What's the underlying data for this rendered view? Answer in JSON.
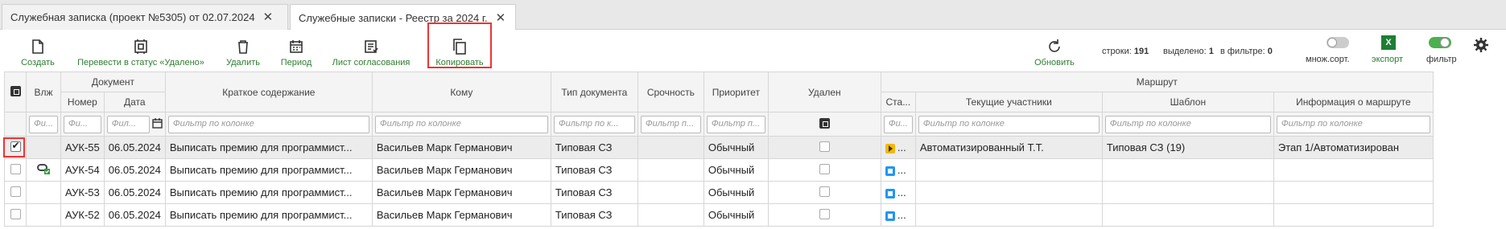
{
  "tabs": [
    {
      "label": "Служебная записка (проект №5305) от 02.07.2024",
      "active": false
    },
    {
      "label": "Служебные записки - Реестр за 2024 г.",
      "active": true
    }
  ],
  "toolbar": {
    "create": "Создать",
    "to_deleted": "Перевести в статус «Удалено»",
    "delete": "Удалить",
    "period": "Период",
    "approval_sheet": "Лист согласования",
    "copy": "Копировать",
    "refresh": "Обновить",
    "multisort": "множ.сорт.",
    "export": "экспорт",
    "export_icon": "X",
    "filter": "фильтр"
  },
  "stats": {
    "rows_label": "строки:",
    "rows": "191",
    "selected_label": "выделено:",
    "selected": "1",
    "in_filter_label": "в фильтре:",
    "in_filter": "0"
  },
  "grid": {
    "group_headers": {
      "document": "Документ",
      "route": "Маршрут"
    },
    "columns": {
      "attach": "Влж",
      "number": "Номер",
      "date": "Дата",
      "summary": "Краткое содержание",
      "to": "Кому",
      "doc_type": "Тип документа",
      "urgency": "Срочность",
      "priority": "Приоритет",
      "deleted": "Удален",
      "status": "Ста...",
      "participants": "Текущие участники",
      "template": "Шаблон",
      "route_info": "Информация о маршруте"
    },
    "filters": {
      "attach": "Фи...",
      "number": "Фи...",
      "date": "Фил...",
      "summary": "Фильтр по колонке",
      "to": "Фильтр по колонке",
      "doc_type": "Фильтр по к...",
      "urgency": "Фильтр п...",
      "priority": "Фильтр п...",
      "status": "Фи...",
      "participants": "Фильтр по колонке",
      "template": "Фильтр по колонке",
      "route_info": "Фильтр по колонке"
    },
    "rows": [
      {
        "selected": true,
        "attach": false,
        "number": "АУК-55",
        "date": "06.05.2024",
        "summary": "Выписать премию для программист...",
        "to": "Васильев Марк Германович",
        "doc_type": "Типовая СЗ",
        "urgency": "",
        "priority": "Обычный",
        "status": "play",
        "status_more": "...",
        "participants": "Автоматизированный Т.Т.",
        "template": "Типовая СЗ (19)",
        "route_info": "Этап 1/Автоматизирован"
      },
      {
        "selected": false,
        "attach": true,
        "number": "АУК-54",
        "date": "06.05.2024",
        "summary": "Выписать премию для программист...",
        "to": "Васильев Марк Германович",
        "doc_type": "Типовая СЗ",
        "urgency": "",
        "priority": "Обычный",
        "status": "square",
        "status_more": "...",
        "participants": "",
        "template": "",
        "route_info": ""
      },
      {
        "selected": false,
        "attach": false,
        "number": "АУК-53",
        "date": "06.05.2024",
        "summary": "Выписать премию для программист...",
        "to": "Васильев Марк Германович",
        "doc_type": "Типовая СЗ",
        "urgency": "",
        "priority": "Обычный",
        "status": "square",
        "status_more": "...",
        "participants": "",
        "template": "",
        "route_info": ""
      },
      {
        "selected": false,
        "attach": false,
        "number": "АУК-52",
        "date": "06.05.2024",
        "summary": "Выписать премию для программист...",
        "to": "Васильев Марк Германович",
        "doc_type": "Типовая СЗ",
        "urgency": "",
        "priority": "Обычный",
        "status": "square",
        "status_more": "...",
        "participants": "",
        "template": "",
        "route_info": ""
      }
    ]
  }
}
